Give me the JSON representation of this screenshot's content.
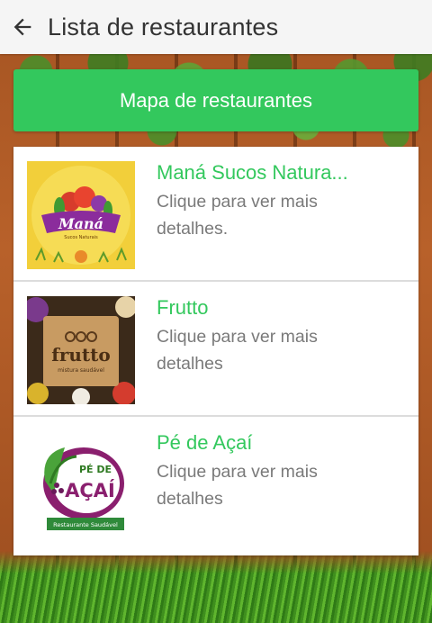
{
  "appbar": {
    "title": "Lista de restaurantes",
    "back_icon": "arrow-left-icon"
  },
  "map_button": {
    "label": "Mapa de restaurantes",
    "color": "#33c85d"
  },
  "restaurants": [
    {
      "name": "Maná Sucos Natura...",
      "description": "Clique para ver mais detalhes.",
      "logo_text": "Maná",
      "logo_subtext": "Sucos Naturais"
    },
    {
      "name": "Frutto",
      "description": "Clique para ver mais detalhes",
      "logo_text": "frutto",
      "logo_subtext": "mistura saudável"
    },
    {
      "name": "Pé de Açaí",
      "description": "Clique para ver mais detalhes",
      "logo_text": "AÇAÍ",
      "logo_small": "PÉ DE",
      "logo_subtext": "Restaurante Saudável"
    }
  ]
}
